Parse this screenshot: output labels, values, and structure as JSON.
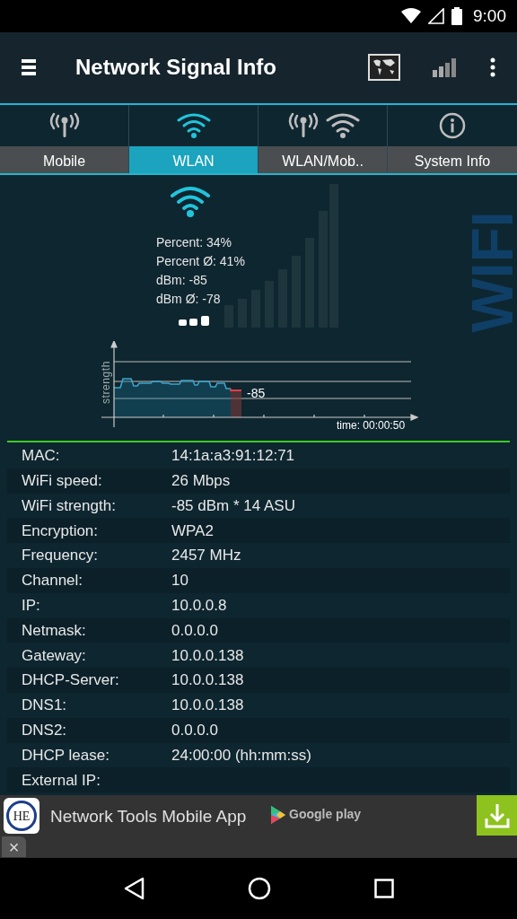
{
  "status_bar": {
    "time": "9:00"
  },
  "app_bar": {
    "title": "Network Signal Info"
  },
  "tabs": [
    {
      "label": "Mobile",
      "kind": "antenna",
      "selected": false
    },
    {
      "label": "WLAN",
      "kind": "wifi",
      "selected": true
    },
    {
      "label": "WLAN/Mob..",
      "kind": "both",
      "selected": false
    },
    {
      "label": "System Info",
      "kind": "info",
      "selected": false
    }
  ],
  "signal": {
    "stats": [
      "Percent: 34%",
      "Percent Ø: 41%",
      "dBm: -85",
      "dBm Ø: -78"
    ],
    "watermark": "WIFI",
    "graph_ylabel": "strength",
    "graph_current": "-85",
    "graph_time": "time: 00:00:50"
  },
  "details": [
    {
      "label": "MAC:",
      "value": "14:1a:a3:91:12:71"
    },
    {
      "label": "WiFi speed:",
      "value": "26 Mbps"
    },
    {
      "label": "WiFi strength:",
      "value": "-85 dBm * 14 ASU"
    },
    {
      "label": "Encryption:",
      "value": "WPA2"
    },
    {
      "label": "Frequency:",
      "value": "2457 MHz"
    },
    {
      "label": "Channel:",
      "value": "10"
    },
    {
      "label": "IP:",
      "value": "10.0.0.8"
    },
    {
      "label": "Netmask:",
      "value": "0.0.0.0"
    },
    {
      "label": "Gateway:",
      "value": "10.0.0.138"
    },
    {
      "label": "DHCP-Server:",
      "value": "10.0.0.138"
    },
    {
      "label": "DNS1:",
      "value": "10.0.0.138"
    },
    {
      "label": "DNS2:",
      "value": "0.0.0.0"
    },
    {
      "label": "DHCP lease:",
      "value": "24:00:00 (hh:mm:ss)"
    },
    {
      "label": "External IP:"
    }
  ],
  "ad": {
    "logo": "HE",
    "text": "Network Tools Mobile App",
    "store": "Google play",
    "close": "×"
  }
}
